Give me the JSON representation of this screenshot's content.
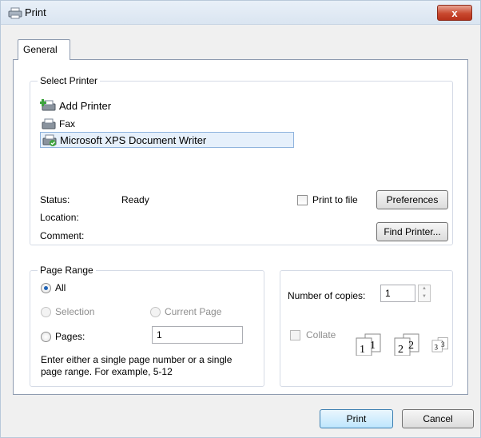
{
  "window": {
    "title": "Print",
    "close_label": "x"
  },
  "tabs": [
    {
      "label": "General"
    }
  ],
  "select_printer": {
    "group_title": "Select Printer",
    "printers": [
      {
        "label": "Add Printer",
        "icon": "add-printer-icon"
      },
      {
        "label": "Fax",
        "icon": "fax-printer-icon"
      },
      {
        "label": "Microsoft XPS Document Writer",
        "icon": "xps-printer-icon",
        "selected": true
      }
    ],
    "status_label": "Status:",
    "status_value": "Ready",
    "location_label": "Location:",
    "comment_label": "Comment:",
    "print_to_file_label": "Print to file",
    "preferences_label": "Preferences",
    "find_printer_label": "Find Printer..."
  },
  "page_range": {
    "group_title": "Page Range",
    "all_label": "All",
    "selection_label": "Selection",
    "current_page_label": "Current Page",
    "pages_label": "Pages:",
    "pages_value": "1",
    "help_line1": "Enter either a single page number or a single",
    "help_line2": "page range.  For example, 5-12"
  },
  "copies": {
    "number_label": "Number of copies:",
    "number_value": "1",
    "collate_label": "Collate",
    "collate_pages": [
      "1",
      "1",
      "2",
      "2",
      "3",
      "3"
    ]
  },
  "footer": {
    "print_label": "Print",
    "cancel_label": "Cancel"
  }
}
